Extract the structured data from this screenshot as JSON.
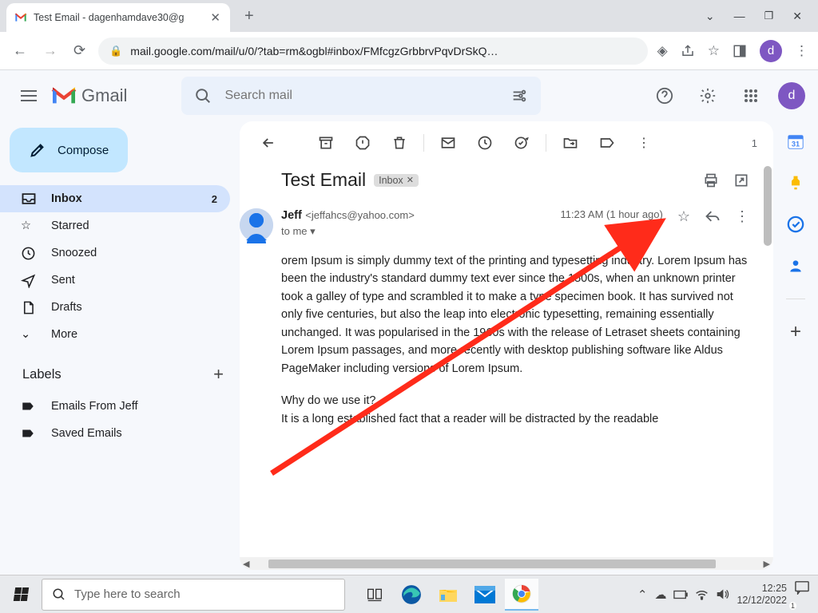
{
  "browser": {
    "tab_title": "Test Email - dagenhamdave30@g",
    "url": "mail.google.com/mail/u/0/?tab=rm&ogbl#inbox/FMfcgzGrbbrvPqvDrSkQ…"
  },
  "gmail": {
    "product_name": "Gmail",
    "search_placeholder": "Search mail",
    "compose_label": "Compose",
    "nav": {
      "inbox": "Inbox",
      "inbox_count": "2",
      "starred": "Starred",
      "snoozed": "Snoozed",
      "sent": "Sent",
      "drafts": "Drafts",
      "more": "More"
    },
    "labels_header": "Labels",
    "labels": {
      "emails_from_jeff": "Emails From Jeff",
      "saved_emails": "Saved Emails"
    },
    "toolbar_page_indicator": "1"
  },
  "email": {
    "subject": "Test Email",
    "chip_label": "Inbox",
    "sender_name": "Jeff",
    "sender_email": "<jeffahcs@yahoo.com>",
    "to_line": "to me",
    "timestamp": "11:23 AM (1 hour ago)",
    "body_p1": "orem Ipsum is simply dummy text of the printing and typesetting industry. Lorem Ipsum has been the industry's standard dummy text ever since the 1500s, when an unknown printer took a galley of type and scrambled it to make a type specimen book. It has survived not only five centuries, but also the leap into electronic typesetting, remaining essentially unchanged. It was popularised in the 1960s with the release of Letraset sheets containing Lorem Ipsum passages, and more recently with desktop publishing software like Aldus PageMaker including versions of Lorem Ipsum.",
    "body_p2_q": "Why do we use it?",
    "body_p2_a": "It is a long established fact that a reader will be distracted by the readable"
  },
  "taskbar": {
    "search_placeholder": "Type here to search",
    "time": "12:25",
    "date": "12/12/2022"
  },
  "colors": {
    "accent": "#1a73e8",
    "compose_bg": "#c2e7ff",
    "active_nav": "#d3e3fd",
    "avatar": "#7e57c2",
    "annotation_red": "#ff2b1a"
  }
}
